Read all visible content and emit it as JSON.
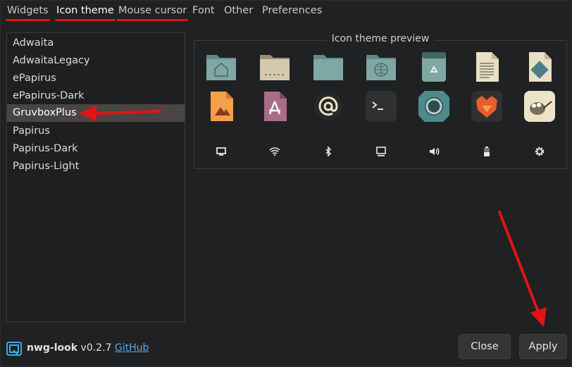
{
  "tabs": [
    {
      "label": "Widgets",
      "underlined": true
    },
    {
      "label": "Icon theme",
      "underlined": true,
      "active": true
    },
    {
      "label": "Mouse cursor",
      "underlined": true
    },
    {
      "label": "Font",
      "underlined": false
    },
    {
      "label": "Other",
      "underlined": false
    },
    {
      "label": "Preferences",
      "underlined": false
    }
  ],
  "theme_list": {
    "items": [
      "Adwaita",
      "AdwaitaLegacy",
      "ePapirus",
      "ePapirus-Dark",
      "GruvboxPlus",
      "Papirus",
      "Papirus-Dark",
      "Papirus-Light"
    ],
    "selected": "GruvboxPlus"
  },
  "preview": {
    "title": "Icon theme preview",
    "row1_icons": [
      "home-folder-icon",
      "desktop-folder-icon",
      "folder-icon",
      "network-folder-icon",
      "trash-icon",
      "text-document-icon",
      "document-icon"
    ],
    "row2_icons": [
      "image-file-icon",
      "app-store-icon",
      "mail-icon",
      "terminal-icon",
      "browser-icon",
      "firefox-icon",
      "gimp-icon"
    ],
    "row3_icons": [
      "display-icon",
      "wifi-icon",
      "bluetooth-icon",
      "computer-icon",
      "volume-icon",
      "battery-icon",
      "settings-icon"
    ]
  },
  "footer": {
    "app_name": "nwg-look",
    "version": " v0.2.7 ",
    "link": "GitHub"
  },
  "buttons": {
    "close": "Close",
    "apply": "Apply"
  },
  "colors": {
    "accent_underline": "#e01414",
    "arrow": "#e01414",
    "selection": "#4a4543",
    "link": "#5fa8e0",
    "background": "#1f2122"
  }
}
